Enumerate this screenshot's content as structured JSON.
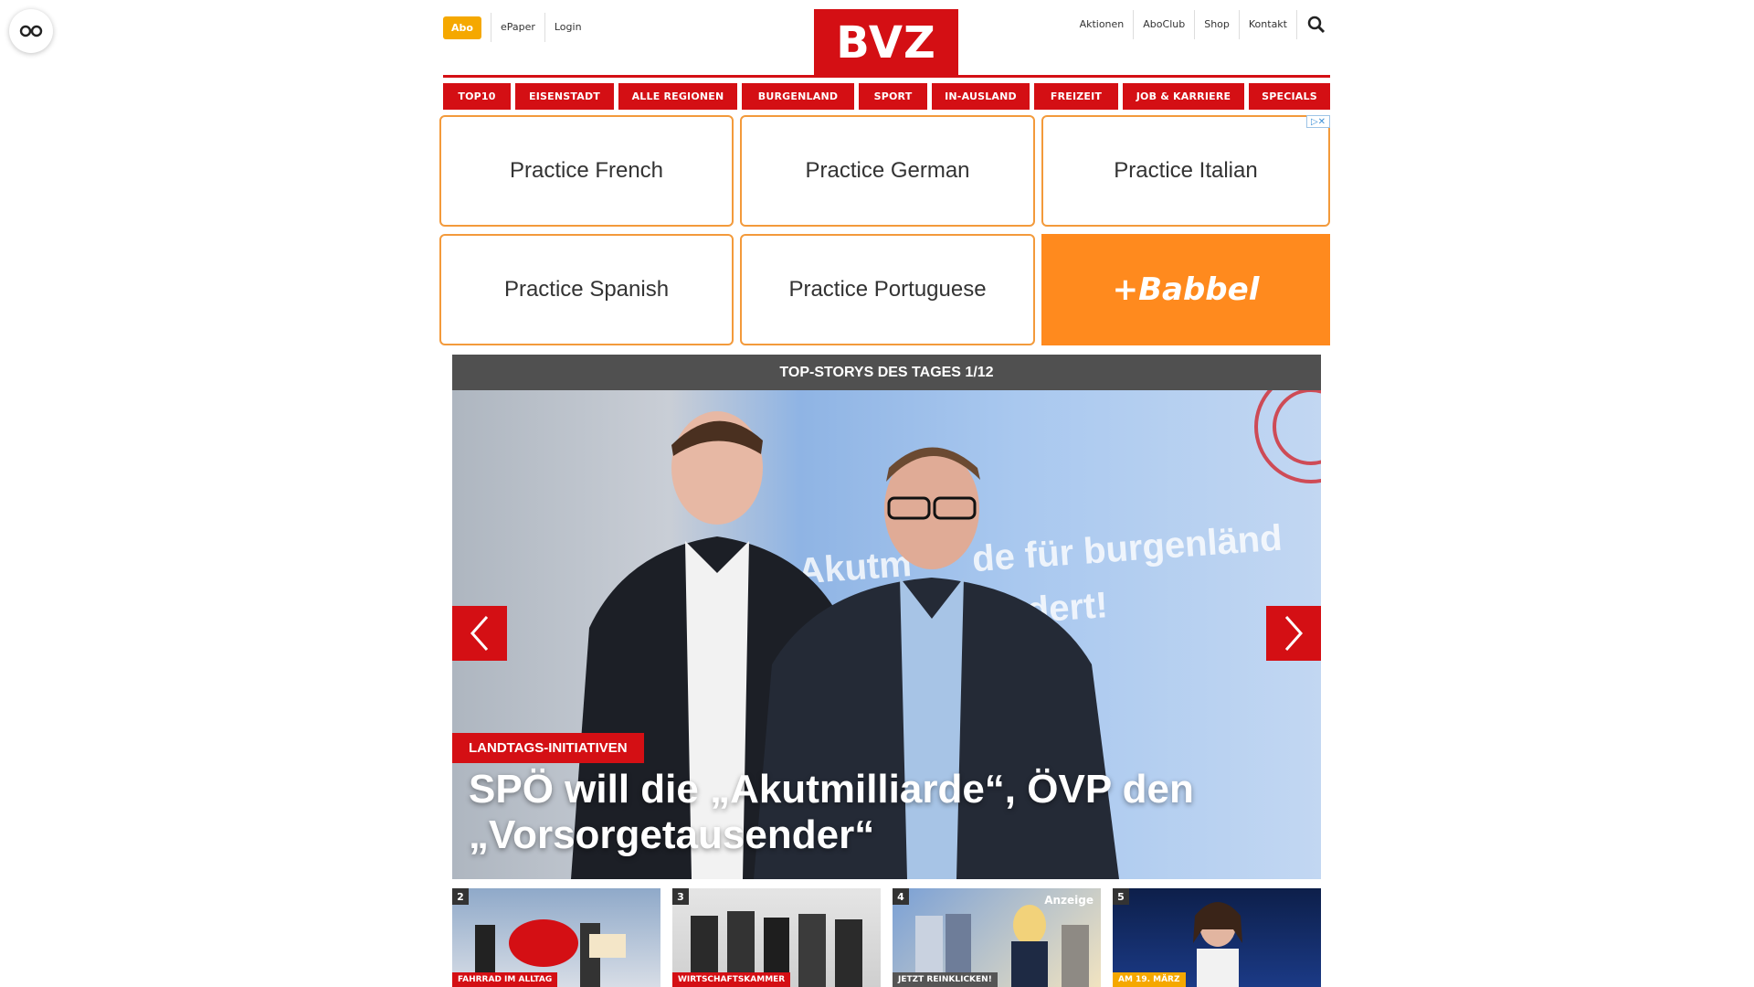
{
  "header": {
    "abo": "Abo",
    "left_links": [
      "ePaper",
      "Login"
    ],
    "logo": "BVZ",
    "right_links": [
      "Aktionen",
      "AboClub",
      "Shop",
      "Kontakt"
    ]
  },
  "nav": {
    "items": [
      "TOP10",
      "EISENSTADT",
      "ALLE REGIONEN",
      "BURGENLAND",
      "SPORT",
      "IN-AUSLAND",
      "FREIZEIT",
      "JOB & KARRIERE",
      "SPECIALS"
    ]
  },
  "ad": {
    "tiles": [
      "Practice French",
      "Practice German",
      "Practice Italian",
      "Practice Spanish",
      "Practice Portuguese"
    ],
    "brand": "+Babbel"
  },
  "slider": {
    "title": "TOP-STORYS DES TAGES 1/12",
    "screen_text": "Akutm      de für burgenländ\n  emei   gefordert!",
    "kicker": "LANDTAGS-INITIATIVEN",
    "headline": "SPÖ will die „Akutmilliarde“, ÖVP den „Vorsorgetausender“"
  },
  "thumbs": [
    {
      "num": "2",
      "tag": "FAHRRAD IM ALLTAG",
      "tag_color": "#d40f14"
    },
    {
      "num": "3",
      "tag": "WIRTSCHAFTSKAMMER",
      "tag_color": "#d40f14"
    },
    {
      "num": "4",
      "tag": "JETZT REINKLICKEN!",
      "tag_color": "#555555",
      "extra": "Anzeige"
    },
    {
      "num": "5",
      "tag": "AM 19. MÄRZ",
      "tag_color": "#f5a800"
    }
  ],
  "colors": {
    "brand_red": "#d40f14",
    "abo_yellow": "#f5a800",
    "babbel_orange": "#ff8a1e"
  }
}
